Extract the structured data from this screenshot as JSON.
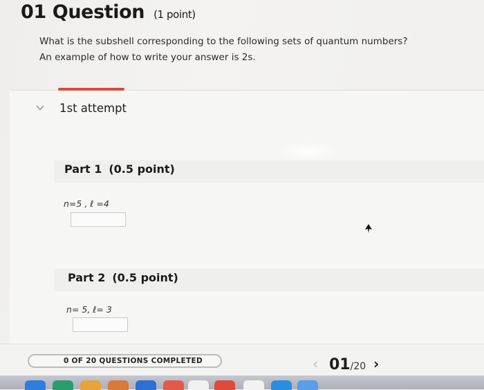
{
  "question": {
    "number": "01",
    "title": "Question",
    "points": "(1 point)",
    "prompt": "What is the subshell corresponding to the following sets of quantum numbers?",
    "example": "An example of how to write your answer is 2s."
  },
  "attempt": {
    "label": "1st attempt",
    "chevron_icon": "chevron-down-icon"
  },
  "parts": [
    {
      "label": "Part 1",
      "points": "(0.5 point)",
      "quantum_numbers": "n=5 , ℓ =4",
      "answer_value": ""
    },
    {
      "label": "Part 2",
      "points": "(0.5 point)",
      "quantum_numbers": "n= 5, ℓ= 3",
      "answer_value": ""
    }
  ],
  "footer": {
    "progress_text": "0 OF 20 QUESTIONS COMPLETED",
    "completed_fraction": 0,
    "current_page": "01",
    "total_pages": "/20",
    "prev_icon": "chevron-left-icon",
    "next_icon": "chevron-right-icon"
  },
  "colors": {
    "accent_red": "#d94a3a",
    "chevron_gray": "#a8a8a8"
  }
}
